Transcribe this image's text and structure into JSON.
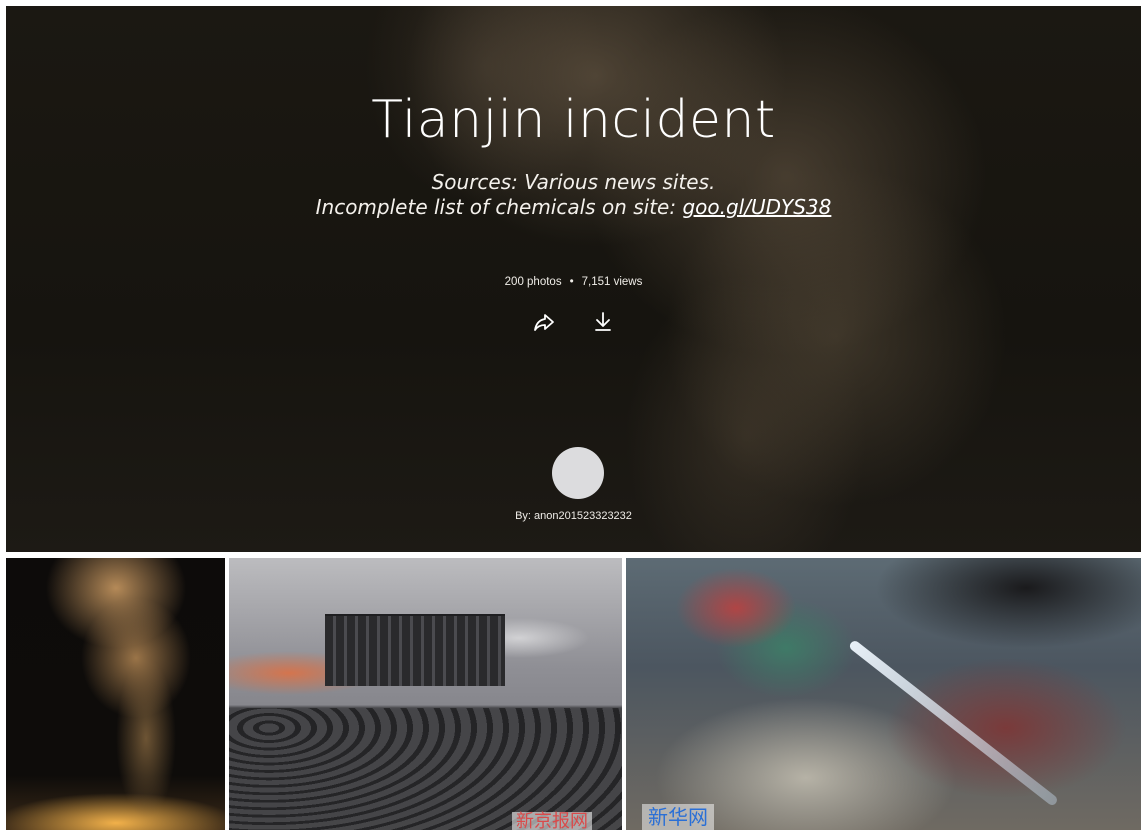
{
  "album": {
    "title": "Tianjin incident",
    "description_line1": "Sources: Various news sites.",
    "description_line2_prefix": "Incomplete list of chemicals on site: ",
    "description_link": "goo.gl/UDYS38",
    "photos_count": "200 photos",
    "stats_separator": "•",
    "views_count": "7,151 views",
    "byline": "By: anon201523323232"
  },
  "actions": {
    "share_icon": "share-arrow-icon",
    "download_icon": "download-icon"
  },
  "thumbnails": [
    {
      "watermark": ""
    },
    {
      "watermark": "新京报网"
    },
    {
      "watermark": "新华网"
    }
  ],
  "colors": {
    "hero_background": "#1b1812",
    "text": "#ffffff",
    "avatar": "#dcdcde"
  }
}
